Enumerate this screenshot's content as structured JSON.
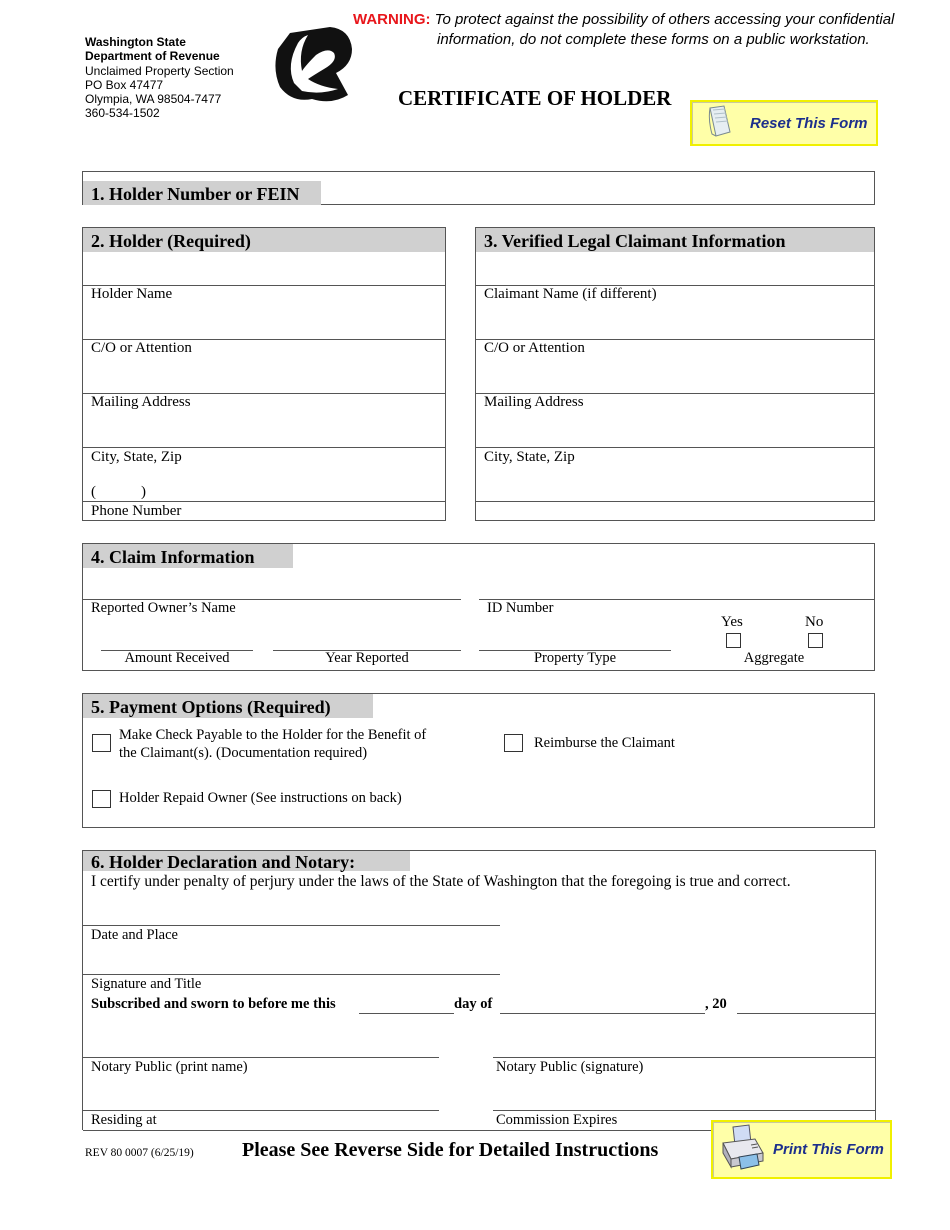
{
  "agency": {
    "line1": "Washington State",
    "line2": "Department of Revenue",
    "line3": "Unclaimed Property Section",
    "line4": "PO Box 47477",
    "line5": "Olympia, WA 98504-7477",
    "line6": "360-534-1502"
  },
  "warning": {
    "label": "WARNING:",
    "line1": "To protect against the possibility of others accessing your confidential",
    "line2": "information, do not complete these forms on a public workstation."
  },
  "title": "CERTIFICATE OF HOLDER",
  "buttons": {
    "reset": "Reset This Form",
    "print": "Print This Form"
  },
  "section1": {
    "heading": "1. Holder Number or FEIN",
    "value": ""
  },
  "section2": {
    "heading": "2. Holder (Required)",
    "fields": [
      "Holder Name",
      "C/O or Attention",
      "Mailing Address",
      "City, State, Zip"
    ],
    "phone_prefix": "(            )",
    "phone_label": "Phone Number"
  },
  "section3": {
    "heading": "3. Verified Legal Claimant Information",
    "fields": [
      "Claimant Name (if different)",
      "C/O or Attention",
      "Mailing Address",
      "City, State, Zip"
    ]
  },
  "section4": {
    "heading": "4. Claim Information",
    "reported_owner": "Reported Owner’s Name",
    "id_number": "ID Number",
    "yes": "Yes",
    "no": "No",
    "amount_received": "Amount Received",
    "year_reported": "Year Reported",
    "property_type": "Property Type",
    "aggregate": "Aggregate",
    "aggregate_yes_checked": false,
    "aggregate_no_checked": false
  },
  "section5": {
    "heading": "5.  Payment Options (Required)",
    "option1_line1": "Make Check Payable to the Holder for the Benefit of",
    "option1_line2": "the Claimant(s). (Documentation required)",
    "option2": "Reimburse the Claimant",
    "option3": "Holder Repaid Owner (See instructions on back)",
    "option1_checked": false,
    "option2_checked": false,
    "option3_checked": false
  },
  "section6": {
    "heading": "6. Holder Declaration and Notary:",
    "certify": "I certify under penalty of perjury under the laws of the State of Washington that the foregoing is true and correct.",
    "date_place": "Date and Place",
    "signature_title": "Signature and Title",
    "sworn_a": "Subscribed and sworn to before me this",
    "sworn_b": "day of",
    "sworn_c": ", 20",
    "notary_print": "Notary Public (print name)",
    "notary_sig": "Notary Public (signature)",
    "residing": "Residing at",
    "commission": "Commission Expires"
  },
  "footer": {
    "rev": "REV 80 0007 (6/25/19)",
    "instructions": "Please See Reverse Side for Detailed Instructions"
  }
}
